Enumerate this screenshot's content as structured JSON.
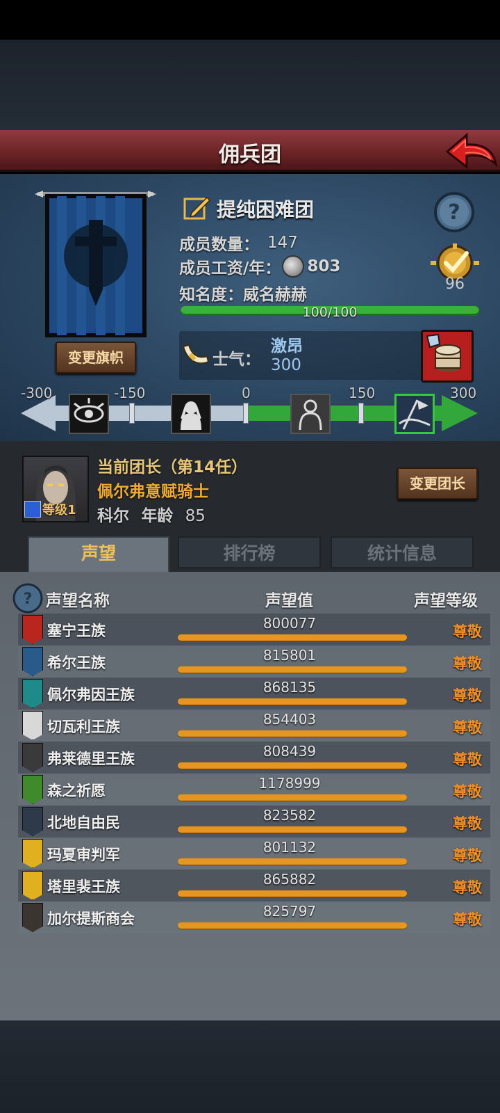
{
  "header": {
    "title": "佣兵团"
  },
  "guild": {
    "name": "提纯困难团",
    "members_label": "成员数量：",
    "members_value": "147",
    "wage_label": "成员工资/年：",
    "wage_value": "803",
    "fame_label": "知名度：",
    "fame_state": "威名赫赫",
    "fame_progress_text": "100/100",
    "fame_progress": 1.0,
    "rank_value": "96",
    "change_flag_label": "变更旗帜"
  },
  "morale": {
    "label": "士气：",
    "state": "激昂",
    "value": "300",
    "track_labels": [
      "-300",
      "-150",
      "0",
      "150",
      "300"
    ],
    "current": 300
  },
  "leader": {
    "title": "当前团长（第14任）",
    "honor": "佩尔弗意赋骑士",
    "name": "科尔",
    "age_label": "年龄",
    "age": "85",
    "level": "等级1",
    "change_label": "变更团长"
  },
  "tabs": [
    {
      "label": "声望",
      "active": true
    },
    {
      "label": "排行榜",
      "active": false
    },
    {
      "label": "统计信息",
      "active": false
    }
  ],
  "reputation": {
    "col_name": "声望名称",
    "col_value": "声望值",
    "col_level": "声望等级",
    "rows": [
      {
        "name": "塞宁王族",
        "value": "800077",
        "level": "尊敬",
        "color": "#b8261e"
      },
      {
        "name": "希尔王族",
        "value": "815801",
        "level": "尊敬",
        "color": "#2a5a8a"
      },
      {
        "name": "佩尔弗因王族",
        "value": "868135",
        "level": "尊敬",
        "color": "#1f8a8a"
      },
      {
        "name": "切瓦利王族",
        "value": "854403",
        "level": "尊敬",
        "color": "#d8d8d8"
      },
      {
        "name": "弗莱德里王族",
        "value": "808439",
        "level": "尊敬",
        "color": "#3a3a3a"
      },
      {
        "name": "森之祈愿",
        "value": "1178999",
        "level": "尊敬",
        "color": "#3f8a2a"
      },
      {
        "name": "北地自由民",
        "value": "823582",
        "level": "尊敬",
        "color": "#2e3a4a"
      },
      {
        "name": "玛夏审判军",
        "value": "801132",
        "level": "尊敬",
        "color": "#e0b020"
      },
      {
        "name": "塔里裴王族",
        "value": "865882",
        "level": "尊敬",
        "color": "#e0b020"
      },
      {
        "name": "加尔提斯商会",
        "value": "825797",
        "level": "尊敬",
        "color": "#3a3530"
      }
    ]
  },
  "colors": {
    "title_bar": "#7a2a2d",
    "fame_green": "#3ab13a",
    "morale_green": "#33a83a",
    "rep_orange": "#e8951e",
    "level_orange": "#f0902a"
  }
}
